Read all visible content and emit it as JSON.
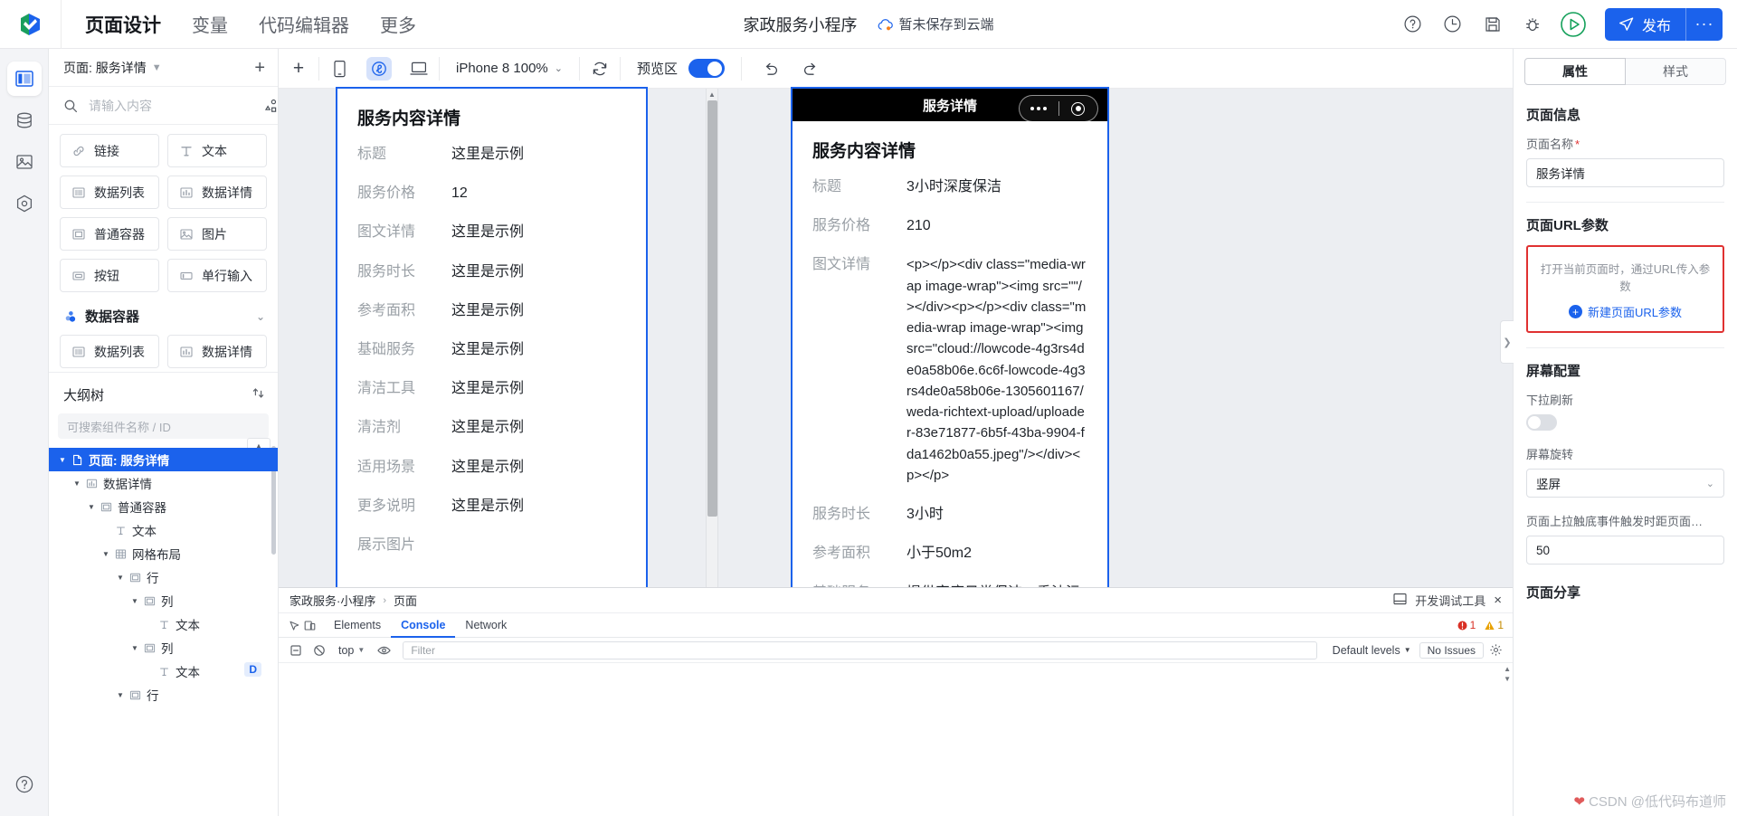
{
  "topbar": {
    "logo": "weda-logo-icon",
    "nav": [
      {
        "label": "页面设计",
        "active": true
      },
      {
        "label": "变量",
        "active": false
      },
      {
        "label": "代码编辑器",
        "active": false
      },
      {
        "label": "更多",
        "active": false
      }
    ],
    "project_name": "家政服务小程序",
    "cloud_status": "暂未保存到云端",
    "icons": [
      "help-icon",
      "history-icon",
      "save-icon",
      "debug-bug-icon",
      "run-play-icon"
    ],
    "publish_label": "发布",
    "publish_more": "···",
    "accent_color": "#1b62ec"
  },
  "rail": {
    "items": [
      {
        "name": "layout-panel-icon",
        "active": true
      },
      {
        "name": "database-icon",
        "active": false
      },
      {
        "name": "image-assets-icon",
        "active": false
      },
      {
        "name": "plugin-icon",
        "active": false
      }
    ],
    "help": "question-mark-icon"
  },
  "left_panel": {
    "page_selector": {
      "label": "页面: 服务详情",
      "add": "+"
    },
    "search": {
      "placeholder": "请输入内容",
      "value": ""
    },
    "components": [
      {
        "label": "链接",
        "icon": "link-icon"
      },
      {
        "label": "文本",
        "icon": "text-icon"
      },
      {
        "label": "数据列表",
        "icon": "list-icon"
      },
      {
        "label": "数据详情",
        "icon": "chart-detail-icon"
      },
      {
        "label": "普通容器",
        "icon": "container-icon"
      },
      {
        "label": "图片",
        "icon": "image-icon"
      },
      {
        "label": "按钮",
        "icon": "button-icon"
      },
      {
        "label": "单行输入",
        "icon": "input-icon"
      }
    ],
    "group": {
      "title": "数据容器",
      "icon": "data-container-icon"
    },
    "group_components": [
      {
        "label": "数据列表",
        "icon": "list-icon"
      },
      {
        "label": "数据详情",
        "icon": "chart-detail-icon"
      }
    ],
    "outline": {
      "title": "大纲树",
      "search_placeholder": "可搜索组件名称 / ID",
      "nodes": [
        {
          "label": "页面: 服务详情",
          "depth": 0,
          "icon": "page-icon",
          "selected": true,
          "expanded": true
        },
        {
          "label": "数据详情",
          "depth": 1,
          "icon": "chart-detail-icon",
          "selected": false,
          "expanded": true
        },
        {
          "label": "普通容器",
          "depth": 2,
          "icon": "container-icon",
          "selected": false,
          "expanded": true
        },
        {
          "label": "文本",
          "depth": 3,
          "icon": "text-icon",
          "selected": false,
          "expanded": false
        },
        {
          "label": "网格布局",
          "depth": 3,
          "icon": "grid-icon",
          "selected": false,
          "expanded": true
        },
        {
          "label": "行",
          "depth": 4,
          "icon": "container-icon",
          "selected": false,
          "expanded": true
        },
        {
          "label": "列",
          "depth": 5,
          "icon": "container-icon",
          "selected": false,
          "expanded": true
        },
        {
          "label": "文本",
          "depth": 6,
          "icon": "text-icon",
          "selected": false,
          "expanded": false
        },
        {
          "label": "列",
          "depth": 5,
          "icon": "container-icon",
          "selected": false,
          "expanded": true
        },
        {
          "label": "文本",
          "depth": 6,
          "icon": "text-icon",
          "selected": false,
          "expanded": false,
          "badge": "D"
        },
        {
          "label": "行",
          "depth": 4,
          "icon": "container-icon",
          "selected": false,
          "expanded": true
        }
      ]
    }
  },
  "canvas_toolbar": {
    "add": "+",
    "devices": [
      {
        "name": "mobile-device-icon",
        "active": false
      },
      {
        "name": "miniprogram-device-icon",
        "active": true
      },
      {
        "name": "desktop-device-icon",
        "active": false
      }
    ],
    "device_label": "iPhone 8 100%",
    "refresh": "refresh-icon",
    "preview_label": "预览区",
    "preview_on": true,
    "undo": "undo-icon",
    "redo": "redo-icon"
  },
  "design_card": {
    "title": "服务内容详情",
    "rows": [
      {
        "key": "标题",
        "value": "这里是示例"
      },
      {
        "key": "服务价格",
        "value": "12"
      },
      {
        "key": "图文详情",
        "value": "这里是示例"
      },
      {
        "key": "服务时长",
        "value": "这里是示例"
      },
      {
        "key": "参考面积",
        "value": "这里是示例"
      },
      {
        "key": "基础服务",
        "value": "这里是示例"
      },
      {
        "key": "清洁工具",
        "value": "这里是示例"
      },
      {
        "key": "清洁剂",
        "value": "这里是示例"
      },
      {
        "key": "适用场景",
        "value": "这里是示例"
      },
      {
        "key": "更多说明",
        "value": "这里是示例"
      },
      {
        "key": "展示图片",
        "value": ""
      }
    ]
  },
  "preview_card": {
    "statusbar_title": "服务详情",
    "title": "服务内容详情",
    "rows": [
      {
        "key": "标题",
        "value": "3小时深度保洁"
      },
      {
        "key": "服务价格",
        "value": "210"
      },
      {
        "key": "图文详情",
        "value": "<p></p><div class=\"media-wrap image-wrap\"><img src=\"\"/></div><p></p><div class=\"media-wrap image-wrap\"><img src=\"cloud://lowcode-4g3rs4de0a58b06e.6c6f-lowcode-4g3rs4de0a58b06e-1305601167/weda-richtext-upload/uploader-83e71877-6b5f-43ba-9904-fda1462b0a55.jpeg\"/></div><p></p>",
        "mono": true
      },
      {
        "key": "服务时长",
        "value": "3小时"
      },
      {
        "key": "参考面积",
        "value": "小于50m2"
      },
      {
        "key": "基础服务",
        "value": "提供家庭日常保洁，重油污清"
      }
    ]
  },
  "right_panel": {
    "tabs": [
      {
        "label": "属性",
        "active": true
      },
      {
        "label": "样式",
        "active": false
      }
    ],
    "page_info": {
      "section_title": "页面信息",
      "name_label": "页面名称",
      "name_required": "*",
      "name_value": "服务详情"
    },
    "url_params": {
      "section_title": "页面URL参数",
      "hint": "打开当前页面时，通过URL传入参数",
      "add_label": "新建页面URL参数",
      "highlight_color": "#e03131"
    },
    "screen_config": {
      "section_title": "屏幕配置",
      "pulldown_label": "下拉刷新",
      "pulldown_on": false,
      "rotate_label": "屏幕旋转",
      "rotate_value": "竖屏",
      "bottom_label": "页面上拉触底事件触发时距页面…",
      "bottom_value": "50"
    },
    "share": {
      "section_title": "页面分享"
    }
  },
  "devtools": {
    "breadcrumb": [
      "家政服务·小程序",
      "页面"
    ],
    "title": "开发调试工具",
    "close": "×",
    "dock_icon": "dock-icon",
    "tabs": [
      {
        "label": "Elements",
        "active": false
      },
      {
        "label": "Console",
        "active": true
      },
      {
        "label": "Network",
        "active": false
      }
    ],
    "error_count": "1",
    "warn_count": "1",
    "toolbar": {
      "clear": "clear-console-icon",
      "ban": "no-entry-icon",
      "context": "top",
      "eye": "eye-icon",
      "filter_placeholder": "Filter",
      "levels": "Default levels",
      "issues": "No Issues",
      "settings": "gear-icon"
    }
  },
  "watermark": "CSDN @低代码布道师"
}
